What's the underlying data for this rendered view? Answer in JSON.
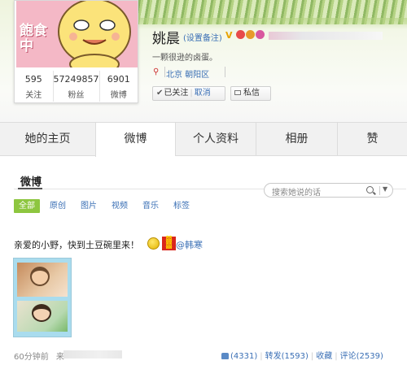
{
  "profile": {
    "name": "姚晨",
    "remark_link": "(设置备注)",
    "verified_badge": "V",
    "bio": "一颗很逊的卤蛋。",
    "location": "北京 朝阳区",
    "avatar_text": "飽食中",
    "stats": [
      {
        "value": "595",
        "label": "关注"
      },
      {
        "value": "57249857",
        "label": "粉丝"
      },
      {
        "value": "6901",
        "label": "微博"
      }
    ],
    "follow_status": "已关注",
    "cancel_label": "取消",
    "message_label": "私信"
  },
  "tabs": [
    {
      "label": "她的主页",
      "active": false
    },
    {
      "label": "微博",
      "active": true
    },
    {
      "label": "个人资料",
      "active": false
    },
    {
      "label": "相册",
      "active": false
    },
    {
      "label": "赞",
      "active": false
    }
  ],
  "feed": {
    "section_title": "微博",
    "search_placeholder": "搜索她说的话",
    "filters": [
      "全部",
      "原创",
      "图片",
      "视频",
      "音乐",
      "标签"
    ],
    "post": {
      "text": "亲爱的小野，快到土豆碗里来！",
      "mention": "@韩寒",
      "time": "60分钟前",
      "source_prefix": "来",
      "likes": "(4331)",
      "repost": "转发(1593)",
      "favorite": "收藏",
      "comment": "评论(2539)"
    }
  },
  "colors": {
    "link": "#3a6fb5",
    "filter_active": "#8dc63f",
    "avatar_bg": "#f4b8c6"
  }
}
